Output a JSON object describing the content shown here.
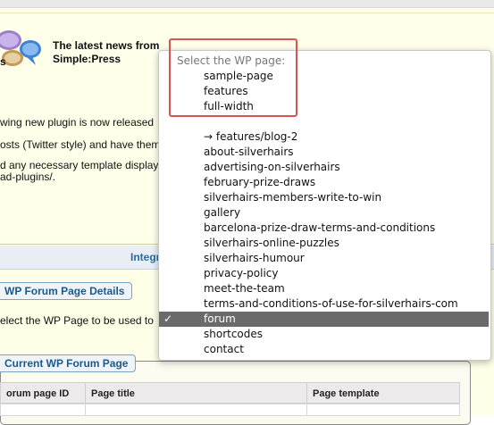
{
  "news": {
    "title_line1": "The latest news from",
    "title_line2": "Simple:Press",
    "logo_partial_text": "s",
    "lines": [
      "wing new plugin is now released",
      "osts (Twitter style) and have them",
      "d any necessary template display",
      "ad-plugins/."
    ]
  },
  "integration": {
    "label": "Integr"
  },
  "sections": {
    "forum_page_details": "WP Forum Page Details",
    "select_instruction": "elect the WP Page to be used to",
    "current_forum_page": "Current WP Forum Page"
  },
  "table": {
    "headers": [
      "orum page ID",
      "Page title",
      "Page template"
    ]
  },
  "dropdown": {
    "header": "Select the WP page:",
    "items": [
      "sample-page",
      "features",
      "full-width",
      "",
      "→ features/blog-2",
      "about-silverhairs",
      "advertising-on-silverhairs",
      "february-prize-draws",
      "silverhairs-members-write-to-win",
      "gallery",
      "barcelona-prize-draw-terms-and-conditions",
      "silverhairs-online-puzzles",
      "silverhairs-humour",
      "privacy-policy",
      "meet-the-team",
      "terms-and-conditions-of-use-for-silverhairs-com",
      "forum",
      "shortcodes",
      "contact"
    ],
    "selected": "forum",
    "checkmark": "✓"
  },
  "colors": {
    "highlight_box": "#d9534f",
    "selected_row": "#6a6a6a",
    "section_label": "#1a5a8c"
  }
}
